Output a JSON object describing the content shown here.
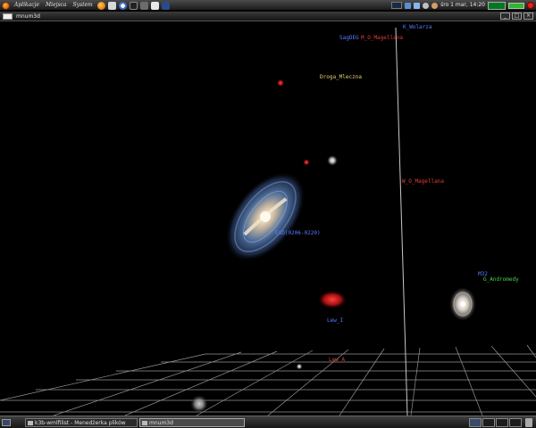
{
  "top_panel": {
    "menus": [
      "Aplikacje",
      "Miejsca",
      "System"
    ],
    "launchers": [
      "firefox-icon",
      "mail-icon",
      "help-icon",
      "terminal-icon",
      "text-editor-icon",
      "file-manager-icon",
      "image-viewer-icon"
    ],
    "clock": "śro  1 mar, 14:20"
  },
  "window": {
    "title": "mnum3d"
  },
  "scene": {
    "labels": [
      {
        "text": "K_Wolarza",
        "color": "#5a7bff"
      },
      {
        "text": "SagDEG",
        "color": "#5a7bff"
      },
      {
        "text": "M_O_Magellana",
        "color": "#e23c3c"
      },
      {
        "text": "Droga_Mleczna",
        "color": "#e8d070"
      },
      {
        "text": "W_O_Magellana",
        "color": "#e23c3c"
      },
      {
        "text": "ESO(0206-0220)",
        "color": "#5a7bff"
      },
      {
        "text": "M32",
        "color": "#5a7bff"
      },
      {
        "text": "G_Andromedy",
        "color": "#4cd44c"
      },
      {
        "text": "Lew_I",
        "color": "#5a7bff"
      },
      {
        "text": "Lew_A",
        "color": "#e23c3c"
      }
    ]
  },
  "taskbar": {
    "tasks": [
      {
        "label": "k3b-wmlfilist - Menedżerka plików",
        "active": false
      },
      {
        "label": "mnum3d",
        "active": true
      }
    ]
  },
  "colors": {
    "axis": "#c8c8c8",
    "grid": "#b0b0b0",
    "background": "#000000"
  }
}
